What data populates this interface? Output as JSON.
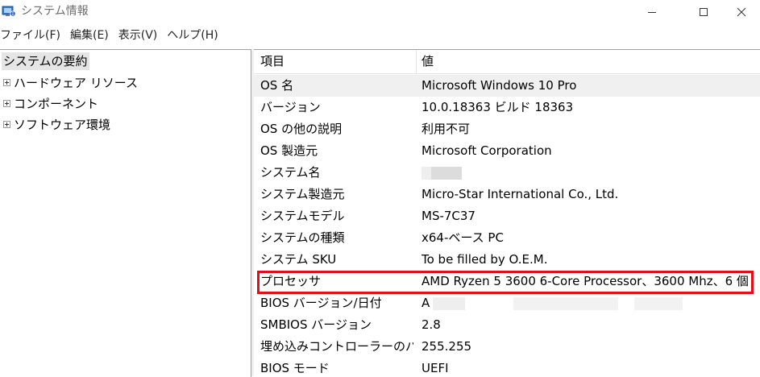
{
  "window": {
    "title": "システム情報",
    "icon": "system-info-icon",
    "controls": {
      "minimize": "minimize-icon",
      "maximize": "maximize-icon",
      "close": "close-icon"
    }
  },
  "menu": [
    {
      "label": "ファイル(F)"
    },
    {
      "label": "編集(E)"
    },
    {
      "label": "表示(V)"
    },
    {
      "label": "ヘルプ(H)"
    }
  ],
  "tree": {
    "root": "システムの要約",
    "nodes": [
      {
        "label": "ハードウェア リソース"
      },
      {
        "label": "コンポーネント"
      },
      {
        "label": "ソフトウェア環境"
      }
    ]
  },
  "list": {
    "headers": {
      "item": "項目",
      "value": "値"
    },
    "rows": [
      {
        "item": "OS 名",
        "value": "Microsoft Windows 10 Pro"
      },
      {
        "item": "バージョン",
        "value": "10.0.18363 ビルド 18363"
      },
      {
        "item": "OS の他の説明",
        "value": "利用不可"
      },
      {
        "item": "OS 製造元",
        "value": "Microsoft Corporation"
      },
      {
        "item": "システム名",
        "value": ""
      },
      {
        "item": "システム製造元",
        "value": "Micro-Star International Co., Ltd."
      },
      {
        "item": "システムモデル",
        "value": "MS-7C37"
      },
      {
        "item": "システムの種類",
        "value": "x64-ベース PC"
      },
      {
        "item": "システム SKU",
        "value": "To be filled by O.E.M."
      },
      {
        "item": "プロセッサ",
        "value": "AMD Ryzen 5 3600 6-Core Processor、3600 Mhz、6 個"
      },
      {
        "item": "BIOS バージョン/日付",
        "value": "A"
      },
      {
        "item": "SMBIOS バージョン",
        "value": "2.8"
      },
      {
        "item": "埋め込みコントローラーのバ...",
        "value": "255.255"
      },
      {
        "item": "BIOS モード",
        "value": "UEFI"
      }
    ]
  },
  "colors": {
    "highlight_border": "#e0101a",
    "alt_row": "#f0f0f0",
    "selected_tree": "#e5e5e5"
  }
}
